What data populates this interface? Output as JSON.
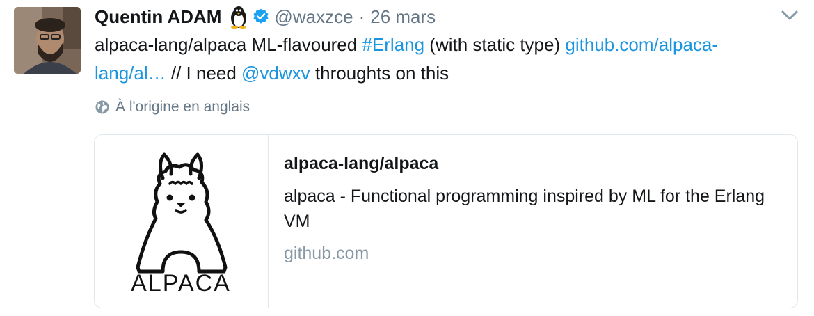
{
  "tweet": {
    "author_name": "Quentin ADAM",
    "handle": "@waxzce",
    "separator": "·",
    "date": "26 mars",
    "text_part1": "alpaca-lang/alpaca ML-flavoured ",
    "hashtag": "#Erlang",
    "text_part2": " (with static type) ",
    "url": "github.com/alpaca-lang/al…",
    "text_part3": " // I need ",
    "mention": "@vdwxv",
    "text_part4": " throughts on this",
    "translate_label": "À l'origine en anglais",
    "icons": [
      "avatar",
      "tux-penguin-icon",
      "verified-badge-icon",
      "chevron-down-icon",
      "globe-icon"
    ]
  },
  "card": {
    "title": "alpaca-lang/alpaca",
    "description": "alpaca - Functional programming inspired by ML for the Erlang VM",
    "domain": "github.com",
    "logo_text": "ALPACA"
  },
  "colors": {
    "link": "#1b95e0",
    "secondary": "#657786",
    "border": "#e1e8ed",
    "verified": "#1da1f2"
  }
}
